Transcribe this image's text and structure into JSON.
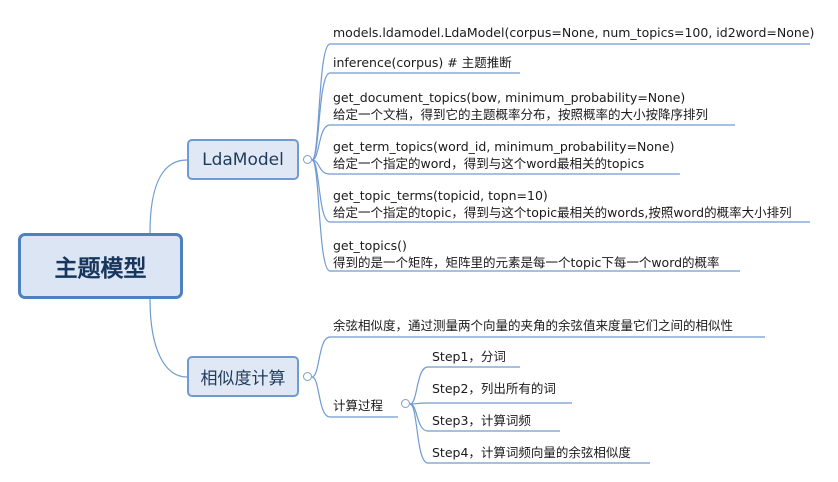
{
  "central": {
    "label": "主题模型"
  },
  "branches": [
    {
      "label": "LdaModel",
      "leaves": [
        {
          "line1": "models.ldamodel.LdaModel(corpus=None, num_topics=100, id2word=None)",
          "line2": ""
        },
        {
          "line1": "inference(corpus) # 主题推断",
          "line2": ""
        },
        {
          "line1": "get_document_topics(bow, minimum_probability=None)",
          "line2": "给定一个文档，得到它的主题概率分布，按照概率的大小按降序排列"
        },
        {
          "line1": "get_term_topics(word_id, minimum_probability=None)",
          "line2": "给定一个指定的word，得到与这个word最相关的topics"
        },
        {
          "line1": "get_topic_terms(topicid, topn=10)",
          "line2": "给定一个指定的topic，得到与这个topic最相关的words,按照word的概率大小排列"
        },
        {
          "line1": "get_topics()",
          "line2": "得到的是一个矩阵，矩阵里的元素是每一个topic下每一个word的概率"
        }
      ]
    },
    {
      "label": "相似度计算",
      "leaves": [
        {
          "line1": "余弦相似度，通过测量两个向量的夹角的余弦值来度量它们之间的相似性"
        }
      ],
      "sub": {
        "label": "计算过程",
        "steps": [
          "Step1，分词",
          "Step2，列出所有的词",
          "Step3，计算词频",
          "Step4，计算词频向量的余弦相似度"
        ]
      }
    }
  ]
}
